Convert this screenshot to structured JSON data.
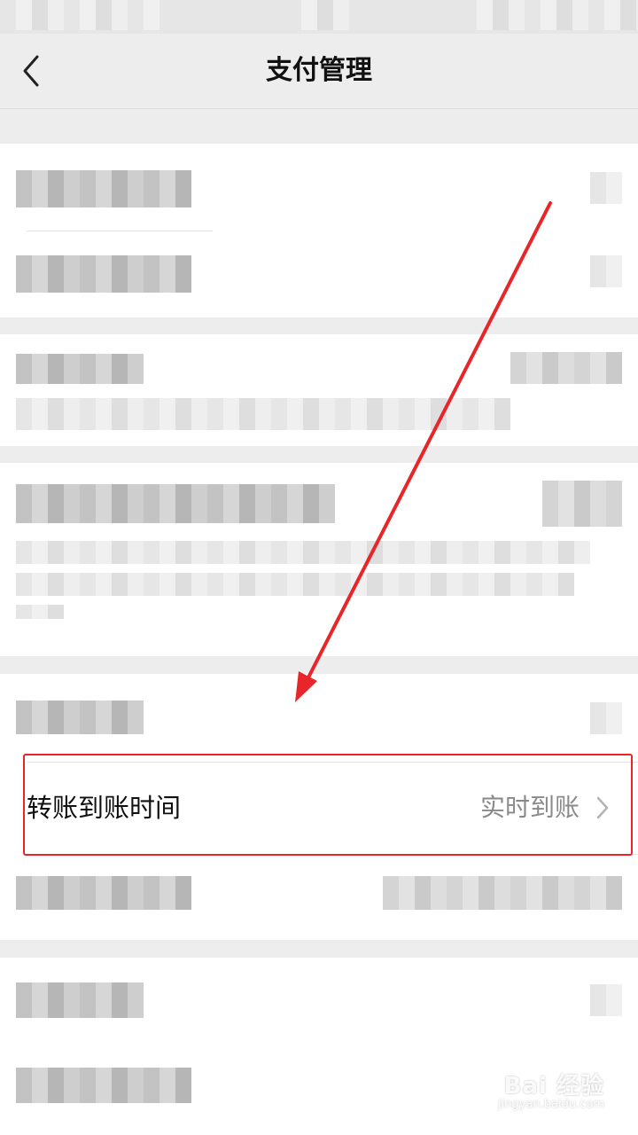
{
  "header": {
    "title": "支付管理"
  },
  "transfer": {
    "label": "转账到账时间",
    "value": "实时到账"
  },
  "watermark": {
    "brand": "Bai 经验",
    "url": "jingyan.baidu.com"
  },
  "colors": {
    "accent": "#e8262a",
    "background": "#ededed",
    "card": "#ffffff"
  },
  "icons": {
    "back": "chevron-left-icon",
    "row": "chevron-right-icon"
  }
}
